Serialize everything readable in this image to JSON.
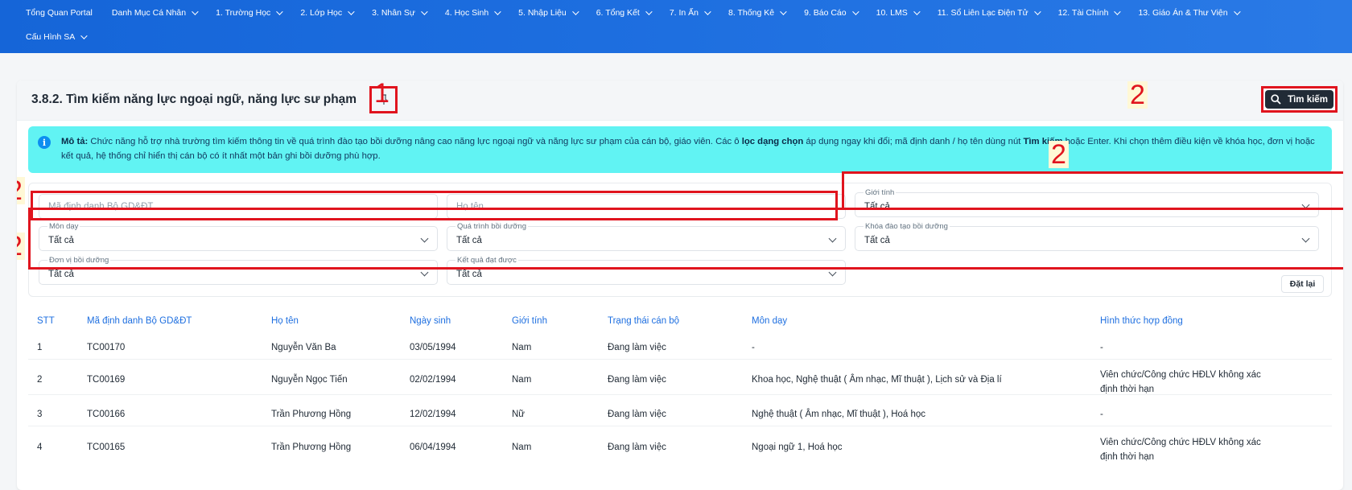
{
  "nav": {
    "row1": [
      {
        "label": "Tổng Quan Portal",
        "has_menu": false
      },
      {
        "label": "Danh Mục Cá Nhân",
        "has_menu": true
      },
      {
        "label": "1. Trường Học",
        "has_menu": true
      },
      {
        "label": "2. Lớp Học",
        "has_menu": true
      },
      {
        "label": "3. Nhân Sự",
        "has_menu": true
      },
      {
        "label": "4. Học Sinh",
        "has_menu": true
      },
      {
        "label": "5. Nhập Liệu",
        "has_menu": true
      },
      {
        "label": "6. Tổng Kết",
        "has_menu": true
      },
      {
        "label": "7. In Ấn",
        "has_menu": true
      },
      {
        "label": "8. Thống Kê",
        "has_menu": true
      },
      {
        "label": "9. Báo Cáo",
        "has_menu": true
      },
      {
        "label": "10. LMS",
        "has_menu": true
      },
      {
        "label": "11. Sổ Liên Lạc Điện Tử",
        "has_menu": true
      },
      {
        "label": "12. Tài Chính",
        "has_menu": true
      },
      {
        "label": "13. Giáo Án & Thư Viện",
        "has_menu": true
      }
    ],
    "row2": [
      {
        "label": "Cấu Hình SA",
        "has_menu": true
      }
    ]
  },
  "header": {
    "title": "3.8.2. Tìm kiếm năng lực ngoại ngữ, năng lực sư phạm",
    "search_label": "Tìm kiếm",
    "icons": {
      "pin": "pin-icon",
      "search": "search-icon"
    }
  },
  "annotations": {
    "pin_marker": "1",
    "search_marker": "2",
    "gender_marker": "2",
    "text_fields_marker": "2",
    "dropdowns_marker": "2"
  },
  "info": {
    "label": "Mô tả:",
    "text_1": " Chức năng hỗ trợ nhà trường tìm kiếm thông tin về quá trình đào tạo bồi dưỡng nâng cao năng lực ngoại ngữ và năng lực sư phạm của cán bộ, giáo viên. Các ô ",
    "bold_1": "lọc dạng chọn",
    "text_2": " áp dụng ngay khi đổi; mã định danh / họ tên dùng nút ",
    "bold_2": "Tìm kiếm",
    "text_3": " hoặc Enter. Khi chọn thêm điều kiện về khóa học, đơn vị hoặc kết quả, hệ thống chỉ hiển thị cán bộ có ít nhất một bản ghi bồi dưỡng phù hợp."
  },
  "filters": {
    "id_placeholder": "Mã định danh Bộ GD&ĐT",
    "name_placeholder": "Họ tên",
    "gender": {
      "label": "Giới tính",
      "value": "Tất cả"
    },
    "subject": {
      "label": "Môn dạy",
      "value": "Tất cả"
    },
    "training_process": {
      "label": "Quá trình bồi dưỡng",
      "value": "Tất cả"
    },
    "training_course": {
      "label": "Khóa đào tạo bồi dưỡng",
      "value": "Tất cả"
    },
    "training_unit": {
      "label": "Đơn vị bồi dưỡng",
      "value": "Tất cả"
    },
    "result": {
      "label": "Kết quả đạt được",
      "value": "Tất cả"
    },
    "reset_label": "Đặt lại"
  },
  "table": {
    "columns": [
      "STT",
      "Mã định danh Bộ GD&ĐT",
      "Họ tên",
      "Ngày sinh",
      "Giới tính",
      "Trạng thái cán bộ",
      "Môn dạy",
      "Hình thức hợp đồng"
    ],
    "rows": [
      [
        "1",
        "TC00170",
        "Nguyễn Văn Ba",
        "03/05/1994",
        "Nam",
        "Đang làm việc",
        "-",
        "-"
      ],
      [
        "2",
        "TC00169",
        "Nguyễn Ngọc Tiến",
        "02/02/1994",
        "Nam",
        "Đang làm việc",
        "Khoa học, Nghệ thuật ( Âm nhạc, Mĩ thuật ), Lịch sử và Địa lí",
        "Viên chức/Công chức HĐLV không xác định thời hạn"
      ],
      [
        "3",
        "TC00166",
        "Trần Phương Hồng",
        "12/02/1994",
        "Nữ",
        "Đang làm việc",
        "Nghệ thuật ( Âm nhạc, Mĩ thuật ), Hoá học",
        "-"
      ],
      [
        "4",
        "TC00165",
        "Trần Phương Hồng",
        "06/04/1994",
        "Nam",
        "Đang làm việc",
        "Ngoại ngữ 1, Hoá học",
        "Viên chức/Công chức HĐLV không xác định thời hạn"
      ]
    ]
  },
  "colors": {
    "nav_bg": "#1565d8",
    "accent": "#1e6fe0",
    "info_bg": "#61f3f3",
    "highlight": "#e0141e",
    "button_dark": "#212b36"
  }
}
